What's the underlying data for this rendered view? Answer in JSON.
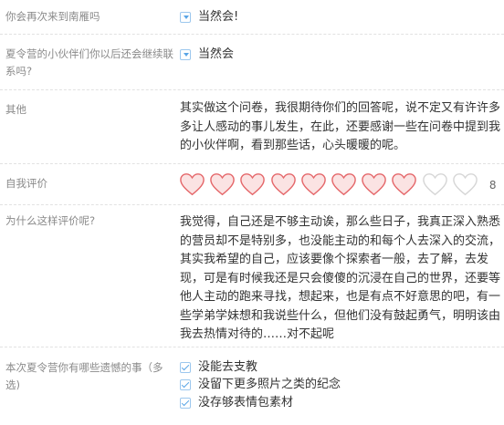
{
  "questions": [
    {
      "label": "你会再次来到南雁吗",
      "answer": "当然会!"
    },
    {
      "label": "夏令营的小伙伴们你以后还会继续联系吗?",
      "answer": "当然会"
    },
    {
      "label": "其他",
      "answer": "其实做这个问卷，我很期待你们的回答呢，说不定又有许许多多让人感动的事儿发生，在此，还要感谢一些在问卷中提到我的小伙伴啊，看到那些话，心头暖暖的呢。"
    },
    {
      "label": "自我评价",
      "rating": 8,
      "max": 10,
      "score_text": "8"
    },
    {
      "label": "为什么这样评价呢?",
      "answer": "我觉得，自己还是不够主动诶，那么些日子，我真正深入熟悉的营员却不是特别多，也没能主动的和每个人去深入的交流，其实我希望的自己，应该要像个探索者一般，去了解，去发现，可是有时候我还是只会傻傻的沉浸在自己的世界，还要等他人主动的跑来寻找，想起来，也是有点不好意思的吧，有一些学弟学妹想和我说些什么，但他们没有鼓起勇气，明明该由我去热情对待的……对不起呢"
    },
    {
      "label": "本次夏令营你有哪些遗憾的事（多选)",
      "options": [
        "没能去支教",
        "没留下更多照片之类的纪念",
        "没存够表情包素材"
      ]
    }
  ],
  "colors": {
    "heart_filled": "#fbe3e3",
    "heart_stroke": "#e5686b",
    "heart_empty_stroke": "#d6d6d6",
    "checkbox": "#5aa5e6"
  },
  "icons": {
    "rating": "heart-icon",
    "select": "chevron-down-icon",
    "checkbox": "checkbox-checked-icon"
  }
}
